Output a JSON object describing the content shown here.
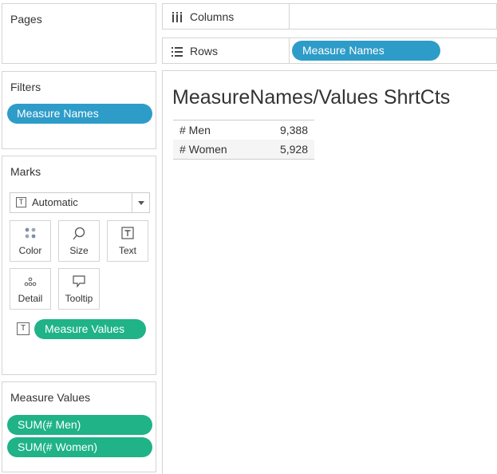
{
  "pages": {
    "title": "Pages"
  },
  "filters": {
    "title": "Filters",
    "pills": [
      "Measure Names"
    ]
  },
  "marks": {
    "title": "Marks",
    "mark_type": "Automatic",
    "buttons": [
      {
        "label": "Color",
        "icon": "color-dots-icon"
      },
      {
        "label": "Size",
        "icon": "size-lasso-icon"
      },
      {
        "label": "Text",
        "icon": "text-box-icon"
      },
      {
        "label": "Detail",
        "icon": "detail-dots-icon"
      },
      {
        "label": "Tooltip",
        "icon": "speech-bubble-icon"
      }
    ],
    "text_field": "Measure Values"
  },
  "measure_values": {
    "title": "Measure Values",
    "pills": [
      "SUM(# Men)",
      "SUM(# Women)"
    ]
  },
  "columns": {
    "label": "Columns"
  },
  "rows": {
    "label": "Rows",
    "pill": "Measure Names"
  },
  "view": {
    "title": "MeasureNames/Values ShrtCts",
    "table": [
      {
        "name": "# Men",
        "value": "9,388"
      },
      {
        "name": "# Women",
        "value": "5,928"
      }
    ]
  },
  "colors": {
    "dimension_pill": "#2e9cc8",
    "measure_pill": "#1fb387"
  }
}
